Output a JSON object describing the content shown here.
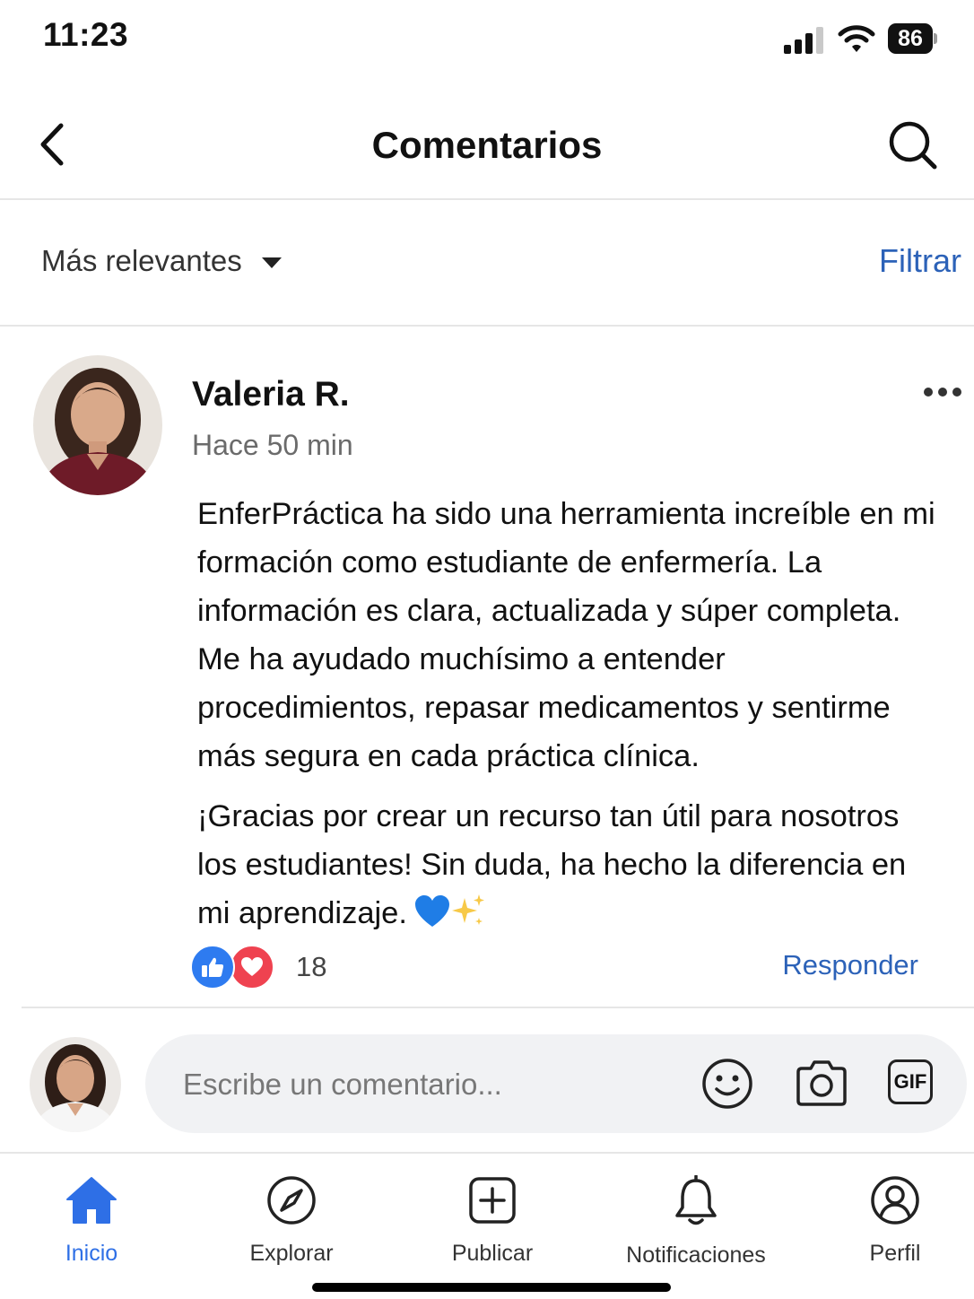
{
  "status_bar": {
    "time": "11:23",
    "battery": "86"
  },
  "header": {
    "title": "Comentarios"
  },
  "sort": {
    "label": "Más relevantes",
    "filter_label": "Filtrar"
  },
  "comment": {
    "author": "Valeria R.",
    "time_ago": "Hace 50 min",
    "paragraph_1": "EnferPráctica ha sido una herramienta increíble en mi formación como estudiante de enfermería. La información es clara, actualizada y súper completa. Me ha ayudado muchísimo a entender procedimientos, repasar medicamentos y sentirme más segura en cada práctica clínica.",
    "paragraph_2": "¡Gracias por crear un recurso tan útil para nosotros los estudiantes! Sin duda, ha hecho la diferencia en mi aprendizaje.",
    "emojis": [
      "blue-heart",
      "sparkles"
    ],
    "reaction_count": "18",
    "reply_label": "Responder"
  },
  "composer": {
    "placeholder": "Escribe un comentario...",
    "gif_label": "GIF"
  },
  "tabs": [
    {
      "label": "Inicio",
      "icon": "home-icon",
      "active": true
    },
    {
      "label": "Explorar",
      "icon": "compass-icon",
      "active": false
    },
    {
      "label": "Publicar",
      "icon": "add-post-icon",
      "active": false
    },
    {
      "label": "Notificaciones",
      "icon": "bell-icon",
      "active": false
    },
    {
      "label": "Perfil",
      "icon": "profile-icon",
      "active": false
    }
  ],
  "colors": {
    "accent": "#2e6fe6",
    "link": "#2c62b8",
    "like": "#2e7bf0",
    "love": "#ef4250"
  }
}
